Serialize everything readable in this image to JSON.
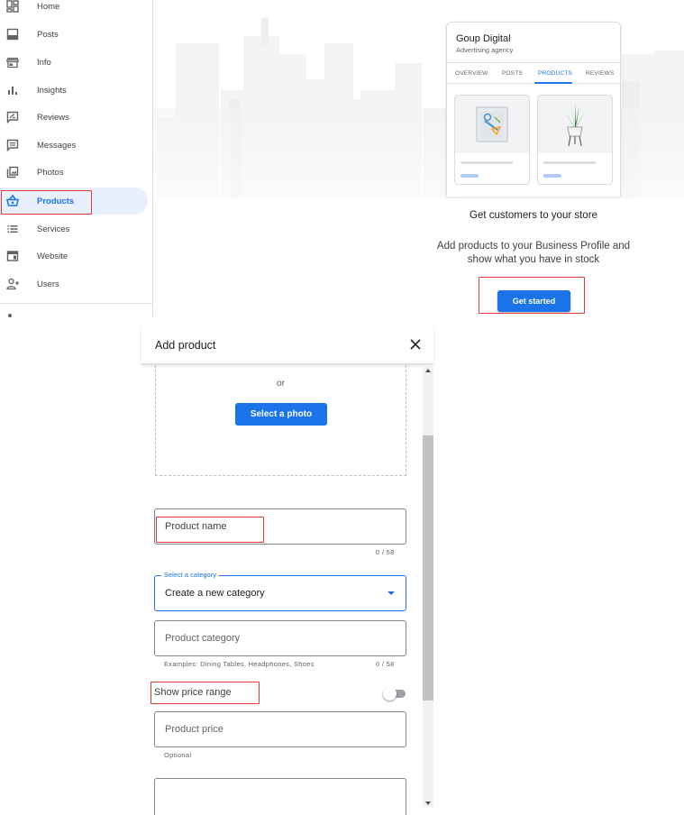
{
  "sidebar": {
    "items": [
      {
        "label": "Home",
        "icon": "dashboard-icon"
      },
      {
        "label": "Posts",
        "icon": "posts-icon"
      },
      {
        "label": "Info",
        "icon": "storefront-icon"
      },
      {
        "label": "Insights",
        "icon": "bar-chart-icon"
      },
      {
        "label": "Reviews",
        "icon": "reviews-icon"
      },
      {
        "label": "Messages",
        "icon": "messages-icon"
      },
      {
        "label": "Photos",
        "icon": "photos-icon"
      },
      {
        "label": "Products",
        "icon": "basket-icon",
        "active": true
      },
      {
        "label": "Services",
        "icon": "list-icon"
      },
      {
        "label": "Website",
        "icon": "website-icon"
      },
      {
        "label": "Users",
        "icon": "add-user-icon"
      }
    ]
  },
  "preview": {
    "business_name": "Goup Digital",
    "business_type": "Advertising agency",
    "tabs": [
      "OVERVIEW",
      "POSTS",
      "PRODUCTS",
      "REVIEWS"
    ],
    "active_tab": "PRODUCTS"
  },
  "cta": {
    "title": "Get customers to your store",
    "description": "Add products to your Business Profile and show what you have in stock",
    "button_label": "Get started"
  },
  "dialog": {
    "title": "Add product",
    "or_text": "or",
    "select_photo_label": "Select a photo",
    "product_name": {
      "placeholder": "Product name",
      "counter": "0 / 58"
    },
    "category_select": {
      "label": "Select a category",
      "value": "Create a new category"
    },
    "product_category": {
      "placeholder": "Product category",
      "helper": "Examples: Dining Tables, Headphones, Shoes",
      "counter": "0 / 58"
    },
    "price_range_label": "Show price range",
    "price_range_on": false,
    "product_price": {
      "placeholder": "Product price",
      "helper": "Optional"
    }
  },
  "colors": {
    "accent": "#1a73e8",
    "highlight": "#e53935"
  }
}
